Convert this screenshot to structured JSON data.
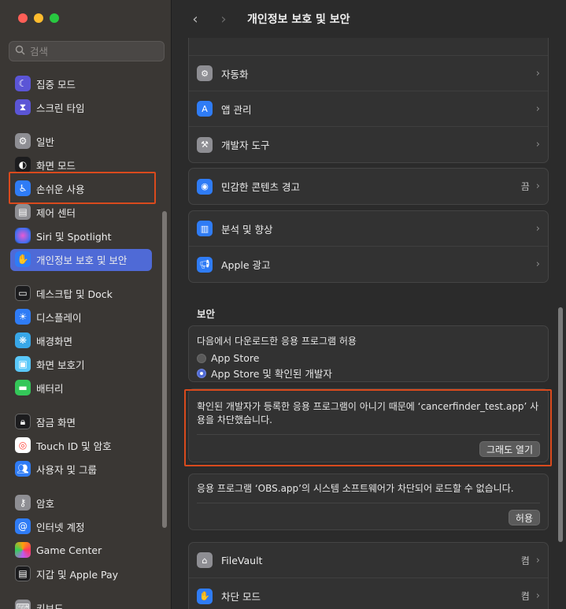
{
  "sidebar": {
    "search_placeholder": "검색",
    "items": [
      {
        "label": "집중 모드",
        "icon": "moon-icon",
        "color": "#5b55d6"
      },
      {
        "label": "스크린 타임",
        "icon": "hourglass-icon",
        "color": "#5b55d6"
      },
      {
        "label": "일반",
        "icon": "gear-icon",
        "color": "#8e8e93"
      },
      {
        "label": "화면 모드",
        "icon": "appearance-icon",
        "color": "#1c1c1e"
      },
      {
        "label": "손쉬운 사용",
        "icon": "accessibility-icon",
        "color": "#2f7cf6"
      },
      {
        "label": "제어 센터",
        "icon": "control-center-icon",
        "color": "#8e8e93"
      },
      {
        "label": "Siri 및 Spotlight",
        "icon": "siri-icon",
        "color": "#b44fd8"
      },
      {
        "label": "개인정보 보호 및 보안",
        "icon": "hand-icon",
        "color": "#2f7cf6"
      },
      {
        "label": "데스크탑 및 Dock",
        "icon": "dock-icon",
        "color": "#1c1c1e"
      },
      {
        "label": "디스플레이",
        "icon": "display-icon",
        "color": "#2f7cf6"
      },
      {
        "label": "배경화면",
        "icon": "wallpaper-icon",
        "color": "#38a7e8"
      },
      {
        "label": "화면 보호기",
        "icon": "screensaver-icon",
        "color": "#5ac8fa"
      },
      {
        "label": "배터리",
        "icon": "battery-icon",
        "color": "#34c759"
      },
      {
        "label": "잠금 화면",
        "icon": "lock-icon",
        "color": "#1c1c1e"
      },
      {
        "label": "Touch ID 및 암호",
        "icon": "fingerprint-icon",
        "color": "#ff453a"
      },
      {
        "label": "사용자 및 그룹",
        "icon": "users-icon",
        "color": "#2f7cf6"
      },
      {
        "label": "암호",
        "icon": "key-icon",
        "color": "#8e8e93"
      },
      {
        "label": "인터넷 계정",
        "icon": "at-icon",
        "color": "#2f7cf6"
      },
      {
        "label": "Game Center",
        "icon": "game-center-icon",
        "color": "#ff9f0a"
      },
      {
        "label": "지갑 및 Apple Pay",
        "icon": "wallet-icon",
        "color": "#1c1c1e"
      },
      {
        "label": "키보드",
        "icon": "keyboard-icon",
        "color": "#8e8e93"
      }
    ]
  },
  "toolbar": {
    "back": "‹",
    "forward": "›",
    "title": "개인정보 보호 및 보안"
  },
  "group1": [
    {
      "label": "자동화",
      "icon": "gears-icon",
      "color": "#8e8e93"
    },
    {
      "label": "앱 관리",
      "icon": "app-store-icon",
      "color": "#2f7cf6"
    },
    {
      "label": "개발자 도구",
      "icon": "hammer-icon",
      "color": "#8e8e93"
    }
  ],
  "sensitive": {
    "label": "민감한 콘텐츠 경고",
    "value": "끔",
    "icon": "eye-icon",
    "color": "#2f7cf6"
  },
  "group3": [
    {
      "label": "분석 및 향상",
      "icon": "chart-icon",
      "color": "#2f7cf6"
    },
    {
      "label": "Apple 광고",
      "icon": "megaphone-icon",
      "color": "#2f7cf6"
    }
  ],
  "security": {
    "title": "보안",
    "allow_text": "다음에서 다운로드한 응용 프로그램 허용",
    "options": [
      "App Store",
      "App Store 및 확인된 개발자"
    ],
    "selected": 1
  },
  "blocked": {
    "message": "확인된 개발자가 등록한 응용 프로그램이 아니기 때문에 ‘cancerfinder_test.app’ 사용을 차단했습니다.",
    "button": "그래도 열기"
  },
  "obs": {
    "message": "응용 프로그램 ‘OBS.app’의 시스템 소프트웨어가 차단되어 로드할 수 없습니다.",
    "button": "허용"
  },
  "group_bottom": [
    {
      "label": "FileVault",
      "value": "켬",
      "icon": "house-icon",
      "color": "#8e8e93"
    },
    {
      "label": "차단 모드",
      "value": "켬",
      "icon": "hand-icon",
      "color": "#2f7cf6"
    }
  ]
}
